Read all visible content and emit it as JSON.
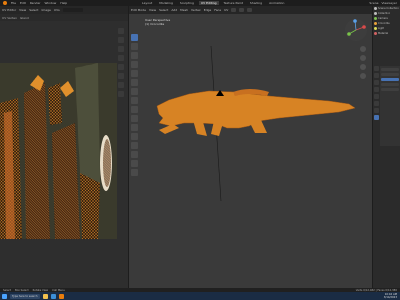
{
  "topbar": {
    "menus": [
      "File",
      "Edit",
      "Render",
      "Window",
      "Help"
    ],
    "workspaces": [
      "Layout",
      "Modeling",
      "Sculpting",
      "UV Editing",
      "Texture Paint",
      "Shading",
      "Animation"
    ],
    "active_workspace": "UV Editing",
    "right_items": [
      "Scene",
      "ViewLayer"
    ]
  },
  "uv_editor": {
    "header_items": [
      "UV Editor",
      "View",
      "Select",
      "Image",
      "UVs"
    ],
    "sub_items": [
      "UV Vertex",
      "Island"
    ]
  },
  "viewport": {
    "header_items": [
      "Edit Mode",
      "View",
      "Select",
      "Add",
      "Mesh",
      "Vertex",
      "Edge",
      "Face",
      "UV"
    ],
    "info_line1": "User Perspective",
    "info_line2": "(1) Crocodile"
  },
  "outliner": {
    "items": [
      {
        "label": "Scene Collection",
        "color": "#bdbdbd"
      },
      {
        "label": "Collection",
        "color": "#bdbdbd"
      },
      {
        "label": "Camera",
        "color": "#7fbf52"
      },
      {
        "label": "Crocodile",
        "color": "#e8a23a"
      },
      {
        "label": "Light",
        "color": "#dcdc5a"
      },
      {
        "label": "Material",
        "color": "#d26262"
      }
    ]
  },
  "statusbar": {
    "items": [
      "Select",
      "Box Select",
      "Rotate View",
      "Call Menu"
    ],
    "right": "Verts 0/12,482 | Faces 0/12,380"
  },
  "taskbar": {
    "search_placeholder": "Type here to search",
    "time": "10:42 AM",
    "date": "3/14/2023"
  },
  "colors": {
    "accent": "#4772b3",
    "mesh_orange": "#e8932a",
    "blender_orange": "#e87d0d"
  }
}
